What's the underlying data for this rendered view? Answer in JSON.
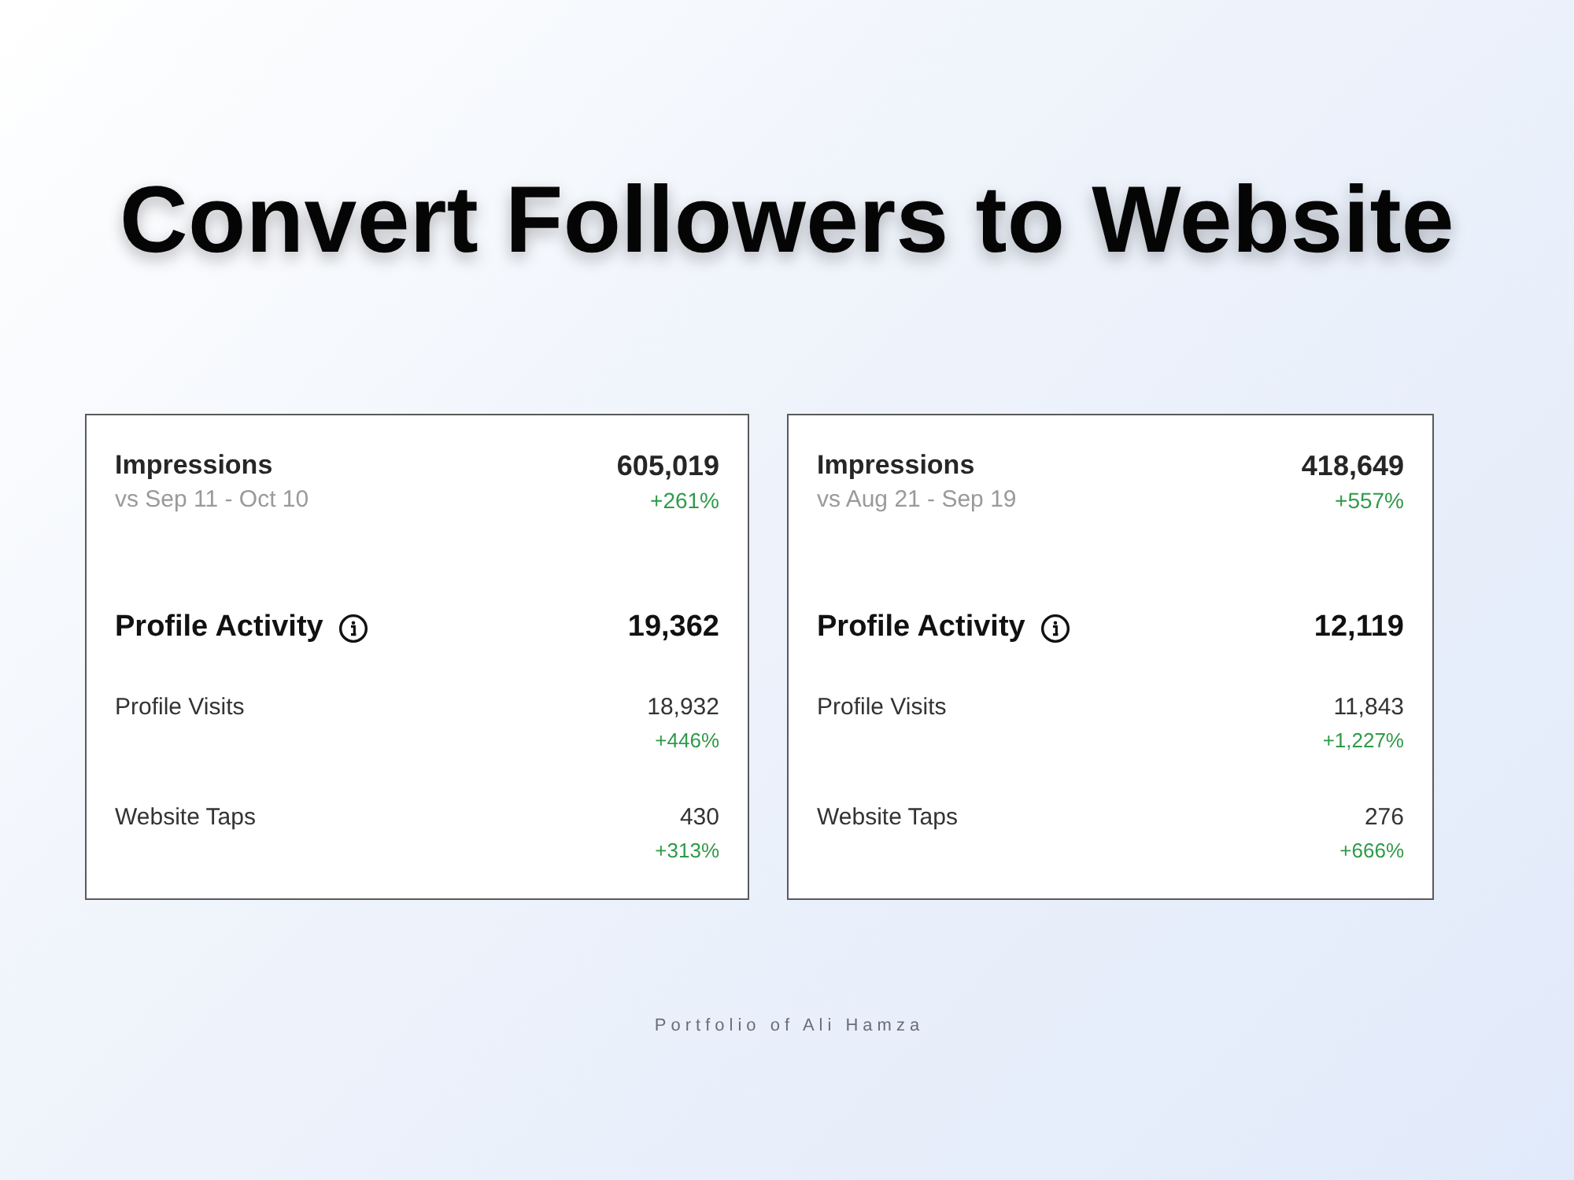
{
  "title": "Convert Followers to Website",
  "cards": [
    {
      "impressions": {
        "label": "Impressions",
        "comparison": "vs Sep 11 - Oct 10",
        "value": "605,019",
        "change": "+261%"
      },
      "profile_activity": {
        "label": "Profile Activity",
        "value": "19,362",
        "rows": [
          {
            "label": "Profile Visits",
            "value": "18,932",
            "change": "+446%"
          },
          {
            "label": "Website Taps",
            "value": "430",
            "change": "+313%"
          }
        ]
      }
    },
    {
      "impressions": {
        "label": "Impressions",
        "comparison": "vs Aug 21 - Sep 19",
        "value": "418,649",
        "change": "+557%"
      },
      "profile_activity": {
        "label": "Profile Activity",
        "value": "12,119",
        "rows": [
          {
            "label": "Profile Visits",
            "value": "11,843",
            "change": "+1,227%"
          },
          {
            "label": "Website Taps",
            "value": "276",
            "change": "+666%"
          }
        ]
      }
    }
  ],
  "footer": "Portfolio of Ali Hamza"
}
